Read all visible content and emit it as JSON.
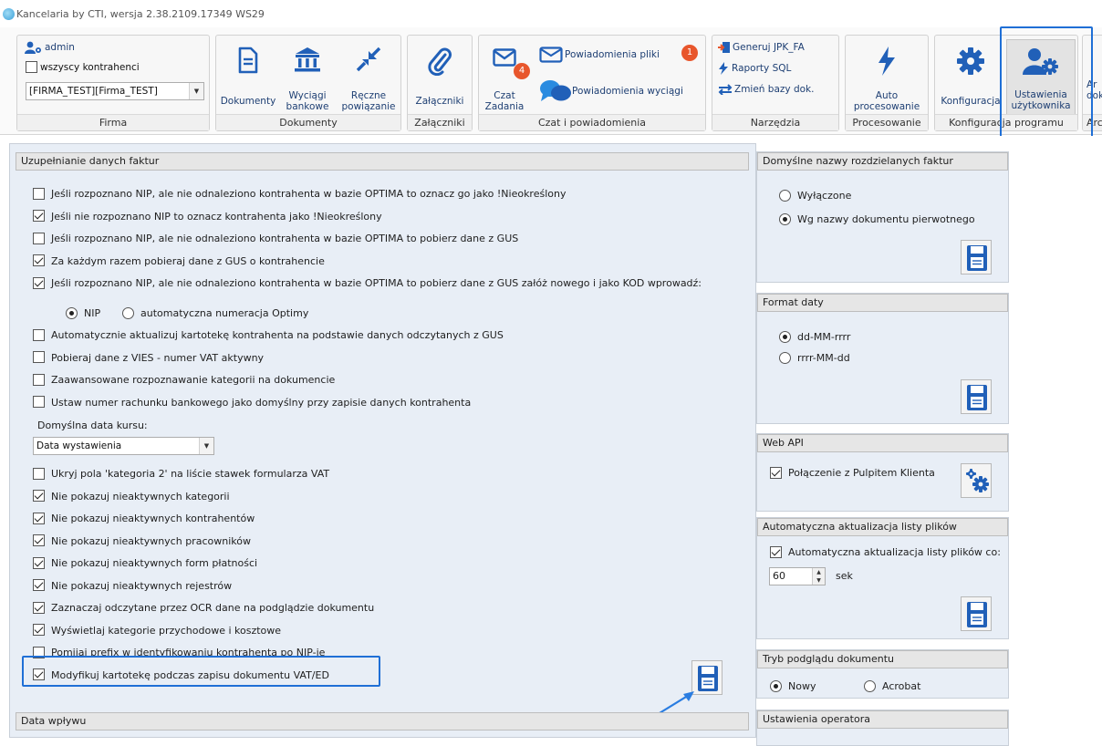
{
  "window": {
    "title": "Kancelaria by CTI, wersja  2.38.2109.17349 WS29"
  },
  "ribbon": {
    "firma": {
      "user": "admin",
      "all_contractors": "wszyscy kontrahenci",
      "company": "[FIRMA_TEST][Firma_TEST]",
      "caption": "Firma"
    },
    "dokumenty": {
      "dokumenty": "Dokumenty",
      "wyciagi_1": "Wyciągi",
      "wyciagi_2": "bankowe",
      "reczne_1": "Ręczne",
      "reczne_2": "powiązanie",
      "caption": "Dokumenty"
    },
    "zalaczniki": {
      "label": "Załączniki",
      "caption": "Załączniki"
    },
    "czat": {
      "czat_1": "Czat",
      "czat_2": "Zadania",
      "czat_badge": "4",
      "pow_pliki": "Powiadomienia pliki",
      "pow_pliki_badge": "1",
      "pow_wyciagi": "Powiadomienia wyciągi",
      "caption": "Czat i powiadomienia"
    },
    "narzedzia": {
      "jpk": "Generuj JPK_FA",
      "sql": "Raporty SQL",
      "zmien": "Zmień bazy dok.",
      "caption": "Narzędzia"
    },
    "procesowanie": {
      "label_1": "Auto",
      "label_2": "procesowanie",
      "caption": "Procesowanie"
    },
    "konfiguracja": {
      "konf": "Konfiguracja",
      "ust_1": "Ustawienia",
      "ust_2": "użytkownika",
      "caption": "Konfiguracja programu"
    },
    "cut": {
      "top": "Ar",
      "mid": "dok",
      "cap": "Arc"
    }
  },
  "left": {
    "section_title": "Uzupełnianie danych faktur",
    "options_1": [
      {
        "label": "Jeśli rozpoznano NIP, ale nie odnaleziono kontrahenta w bazie OPTIMA to oznacz go jako !Nieokreślony",
        "checked": false
      },
      {
        "label": "Jeśli nie rozpoznano NIP to oznacz kontrahenta jako !Nieokreślony",
        "checked": true
      },
      {
        "label": "Jeśli rozpoznano NIP, ale nie odnaleziono kontrahenta w bazie OPTIMA to pobierz dane z GUS",
        "checked": false
      },
      {
        "label": "Za każdym razem pobieraj dane z GUS o kontrahencie",
        "checked": true
      },
      {
        "label": "Jeśli rozpoznano NIP, ale nie odnaleziono kontrahenta w bazie OPTIMA to pobierz dane z GUS załóż nowego i jako KOD wprowadź:",
        "checked": true
      }
    ],
    "kod_radio": {
      "nip": "NIP",
      "auto": "automatyczna numeracja Optimy",
      "selected": "nip"
    },
    "options_2": [
      {
        "label": "Automatycznie aktualizuj kartotekę kontrahenta na podstawie danych odczytanych z GUS",
        "checked": false
      },
      {
        "label": "Pobieraj dane z VIES - numer VAT aktywny",
        "checked": false
      },
      {
        "label": "Zaawansowane rozpoznawanie kategorii na dokumencie",
        "checked": false
      },
      {
        "label": "Ustaw numer rachunku bankowego jako domyślny przy zapisie danych kontrahenta",
        "checked": false
      }
    ],
    "rate_date": {
      "label": "Domyślna data kursu:",
      "value": "Data wystawienia"
    },
    "options_3": [
      {
        "label": "Ukryj pola 'kategoria 2' na liście stawek formularza VAT",
        "checked": false
      },
      {
        "label": "Nie pokazuj nieaktywnych kategorii",
        "checked": true
      },
      {
        "label": "Nie pokazuj nieaktywnych kontrahentów",
        "checked": true
      },
      {
        "label": "Nie pokazuj nieaktywnych pracowników",
        "checked": true
      },
      {
        "label": "Nie pokazuj nieaktywnych form płatności",
        "checked": true
      },
      {
        "label": "Nie pokazuj nieaktywnych rejestrów",
        "checked": true
      },
      {
        "label": "Zaznaczaj odczytane przez OCR dane na podglądzie dokumentu",
        "checked": true
      },
      {
        "label": "Wyświetlaj kategorie przychodowe i kosztowe",
        "checked": true
      },
      {
        "label": "Pomijaj prefix w identyfikowaniu kontrahenta po NIP-ie",
        "checked": false
      },
      {
        "label": "Modyfikuj kartotekę podczas zapisu dokumentu VAT/ED",
        "checked": true
      }
    ],
    "next_section": "Data wpływu"
  },
  "right": {
    "split_names": {
      "title": "Domyślne nazwy rozdzielanych faktur",
      "off": "Wyłączone",
      "by_name": "Wg nazwy dokumentu pierwotnego",
      "selected": "by_name"
    },
    "date_format": {
      "title": "Format daty",
      "opt1": "dd-MM-rrrr",
      "opt2": "rrrr-MM-dd",
      "selected": "opt1"
    },
    "web_api": {
      "title": "Web API",
      "label": "Połączenie z Pulpitem Klienta",
      "checked": true
    },
    "auto_update": {
      "title": "Automatyczna aktualizacja listy plików",
      "label": "Automatyczna aktualizacja listy plików co:",
      "checked": true,
      "value": "60",
      "unit": "sek"
    },
    "preview_mode": {
      "title": "Tryb podglądu dokumentu",
      "new": "Nowy",
      "acrobat": "Acrobat",
      "selected": "new"
    },
    "operator": {
      "title": "Ustawienia operatora"
    }
  },
  "colors": {
    "accent": "#1f6fd6",
    "icon_blue": "#2160b8",
    "badge": "#e8562c"
  },
  "icons": [
    "user-gear-icon",
    "document-icon",
    "bank-icon",
    "compress-arrows-icon",
    "paperclip-icon",
    "mail-icon",
    "chat-bubbles-icon",
    "lightning-icon",
    "gear-icon",
    "save-icon"
  ]
}
